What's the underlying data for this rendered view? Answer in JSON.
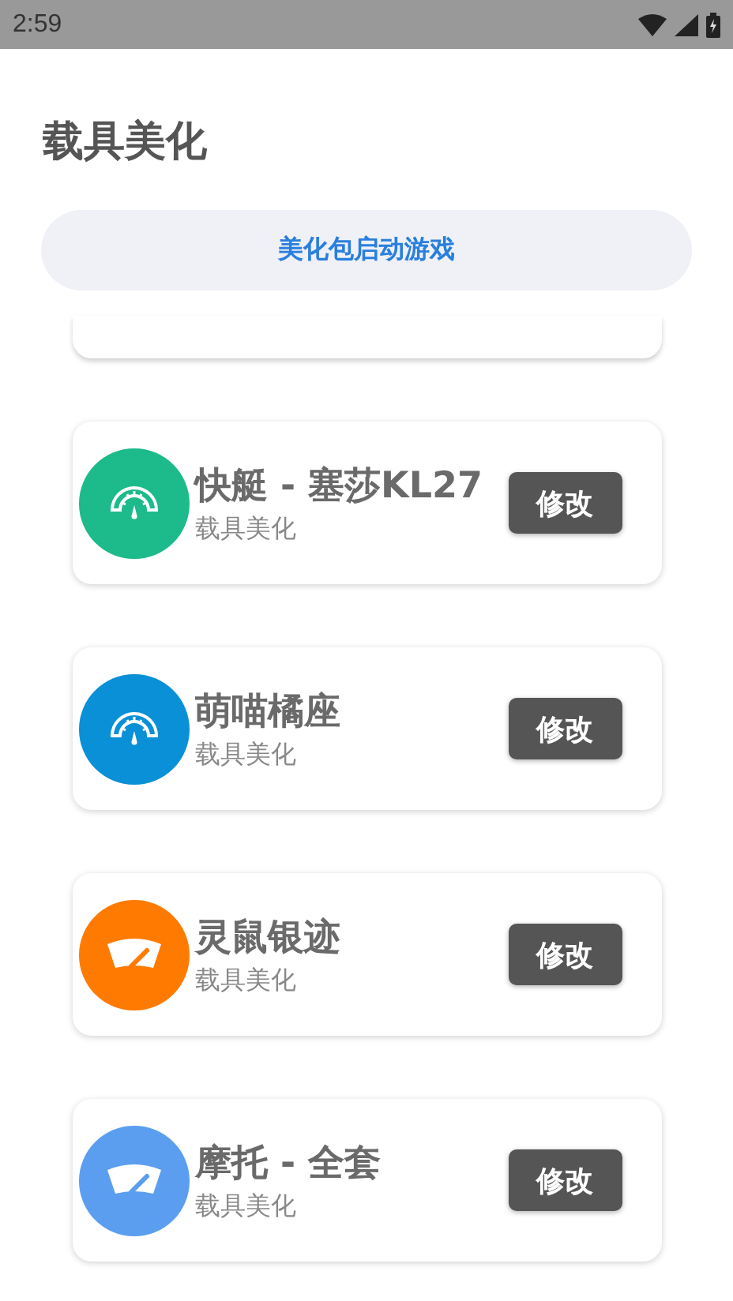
{
  "status_bar": {
    "time": "2:59"
  },
  "title": "载具美化",
  "launch_button": "美化包启动游戏",
  "items": [
    {
      "name": "快艇 - 塞莎KL27",
      "subtitle": "载具美化",
      "kind": "gauge",
      "color": "#1dba8b",
      "action": "修改"
    },
    {
      "name": "萌喵橘座",
      "subtitle": "载具美化",
      "kind": "gauge",
      "color": "#0a90d6",
      "action": "修改"
    },
    {
      "name": "灵鼠银迹",
      "subtitle": "载具美化",
      "kind": "wiper",
      "color": "#ff7a00",
      "action": "修改"
    },
    {
      "name": "摩托 - 全套",
      "subtitle": "载具美化",
      "kind": "wiper",
      "color": "#5b9ef0",
      "action": "修改"
    }
  ]
}
